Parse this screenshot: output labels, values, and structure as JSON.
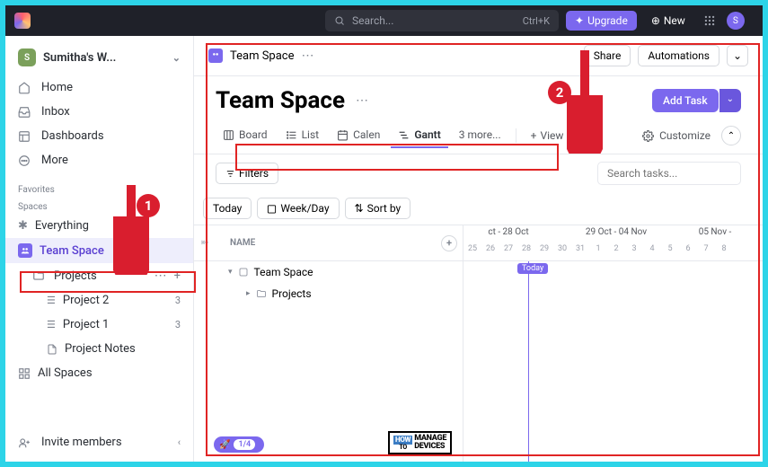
{
  "topbar": {
    "search_placeholder": "Search...",
    "search_kbd": "Ctrl+K",
    "upgrade": "Upgrade",
    "new": "New",
    "avatar_initial": "S"
  },
  "workspace": {
    "name": "Sumitha's W...",
    "badge": "S"
  },
  "nav": {
    "home": "Home",
    "inbox": "Inbox",
    "dashboards": "Dashboards",
    "more": "More"
  },
  "sections": {
    "favorites": "Favorites",
    "spaces": "Spaces"
  },
  "spaces": {
    "everything": "Everything",
    "team_space": "Team Space",
    "projects": "Projects",
    "project2": "Project 2",
    "project2_count": "3",
    "project1": "Project 1",
    "project1_count": "3",
    "project_notes": "Project Notes",
    "all_spaces": "All Spaces"
  },
  "footer": {
    "invite": "Invite members"
  },
  "breadcrumb": {
    "title": "Team Space",
    "share": "Share",
    "automations": "Automations"
  },
  "hero": {
    "title": "Team Space",
    "add_task": "Add Task"
  },
  "views": {
    "board": "Board",
    "list": "List",
    "calendar": "Calen",
    "gantt": "Gantt",
    "more": "3 more...",
    "add": "View",
    "customize": "Customize"
  },
  "filters": {
    "filters": "Filters",
    "search_placeholder": "Search tasks..."
  },
  "gantt_toolbar": {
    "today": "Today",
    "week_day": "Week/Day",
    "sort_by": "Sort by"
  },
  "gantt": {
    "name_col": "NAME",
    "tree_root": "Team Space",
    "tree_child": "Projects",
    "month1": "ct - 28 Oct",
    "month2": "29 Oct - 04 Nov",
    "month3": "05 Nov -",
    "days": [
      "25",
      "26",
      "27",
      "28",
      "29",
      "30",
      "31",
      "1",
      "2",
      "3",
      "4",
      "5",
      "6",
      "7",
      "8"
    ],
    "today": "Today"
  },
  "annotations": {
    "num1": "1",
    "num2": "2"
  },
  "rocket": {
    "frac": "1/4"
  },
  "watermark": {
    "how": "HOW",
    "to": "TO",
    "manage": "MANAGE",
    "devices": "DEVICES"
  }
}
